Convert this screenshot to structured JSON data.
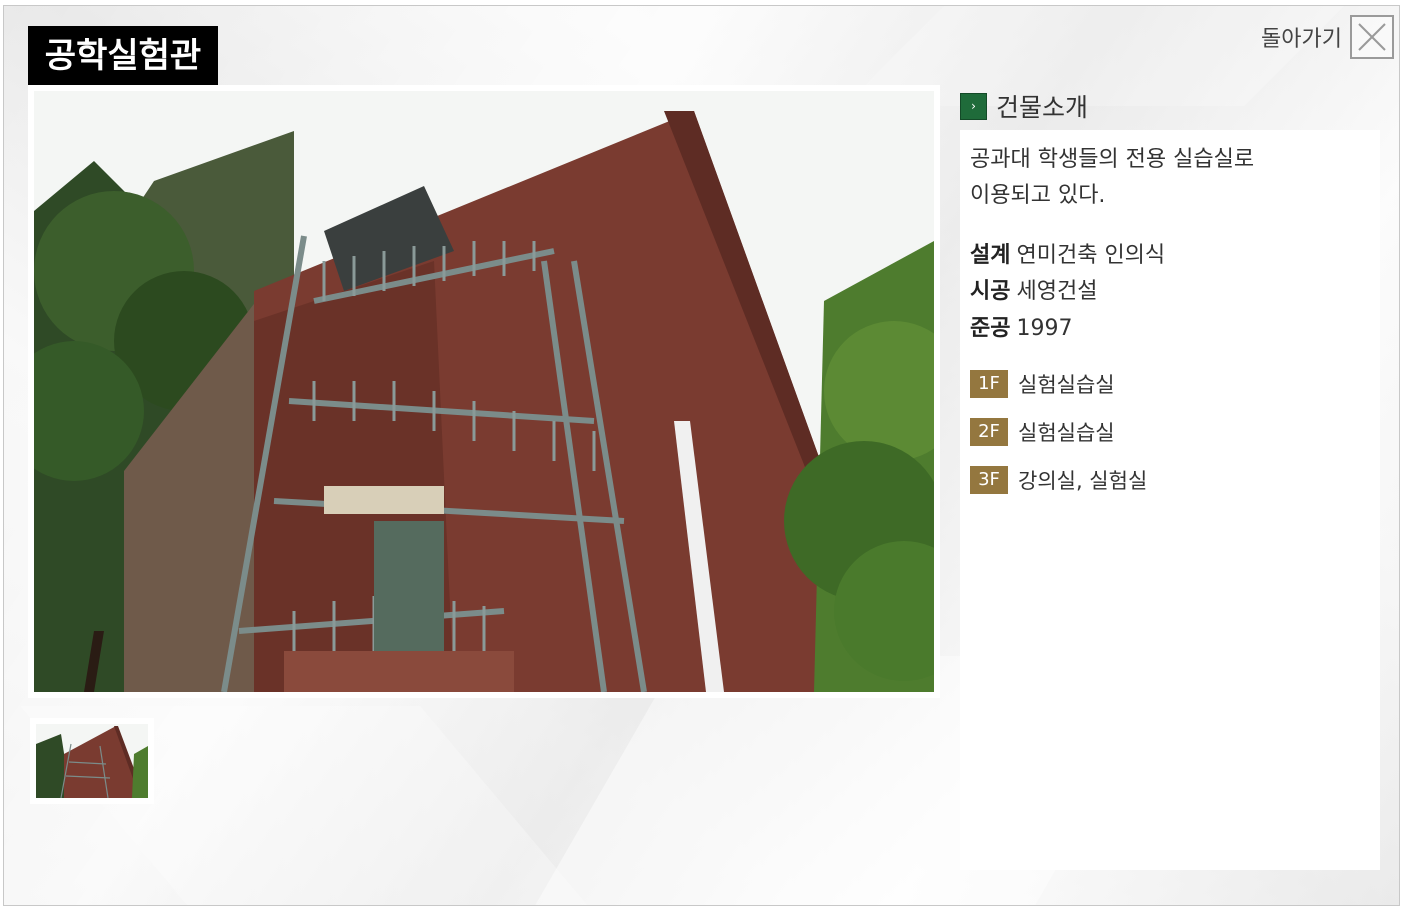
{
  "header": {
    "title": "공학실험관",
    "back_label": "돌아가기"
  },
  "gallery": {
    "main_image": "engineering-lab-building-photo",
    "thumbnails": [
      "engineering-lab-building-thumbnail"
    ]
  },
  "info": {
    "section_title": "건물소개",
    "description_line1": "공과대 학생들의 전용 실습실로",
    "description_line2": "이용되고 있다.",
    "specs": [
      {
        "label": "설계",
        "value": "연미건축 인의식"
      },
      {
        "label": "시공",
        "value": "세영건설"
      },
      {
        "label": "준공",
        "value": "1997"
      }
    ],
    "floors": [
      {
        "floor": "1F",
        "use": "실험실습실"
      },
      {
        "floor": "2F",
        "use": "실험실습실"
      },
      {
        "floor": "3F",
        "use": "강의실, 실험실"
      }
    ]
  },
  "colors": {
    "title_bg": "#000000",
    "floor_badge": "#94773f",
    "section_bullet": "#1f6b3a"
  }
}
